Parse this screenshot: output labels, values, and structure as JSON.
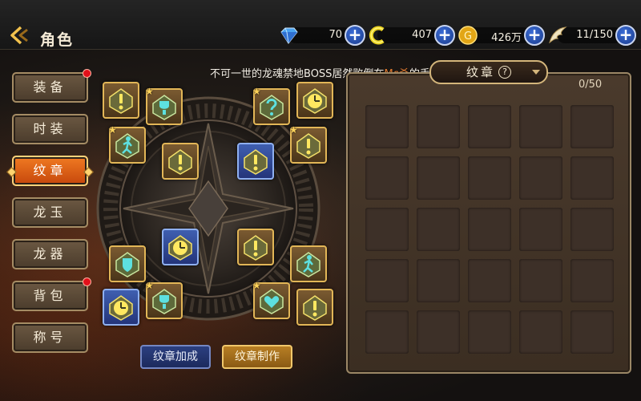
{
  "header": {
    "title": "角色",
    "resources": [
      {
        "icon": "diamond-icon",
        "value": "70"
      },
      {
        "icon": "c-coin-icon",
        "value": "407"
      },
      {
        "icon": "gold-coin-icon",
        "value": "426万"
      },
      {
        "icon": "wing-icon",
        "value": "11/150"
      }
    ]
  },
  "announcement": {
    "prefix": "不可一世的龙魂禁地BOSS居然败倒在",
    "name": "Mc杀",
    "suffix": "的手下"
  },
  "tabs": [
    {
      "label": "装备",
      "badge": true,
      "active": false
    },
    {
      "label": "时装",
      "badge": false,
      "active": false
    },
    {
      "label": "纹章",
      "badge": false,
      "active": true
    },
    {
      "label": "龙玉",
      "badge": false,
      "active": false
    },
    {
      "label": "龙器",
      "badge": false,
      "active": false
    },
    {
      "label": "背包",
      "badge": true,
      "active": false
    },
    {
      "label": "称号",
      "badge": false,
      "active": false
    }
  ],
  "emblem_slots": [
    {
      "name": "exclaim",
      "color": "gold",
      "star": false
    },
    {
      "name": "trophy",
      "color": "gold",
      "star": true
    },
    {
      "name": "runner",
      "color": "gold",
      "star": true
    },
    {
      "name": "exclaim",
      "color": "gold",
      "star": false
    },
    {
      "name": "question",
      "color": "gold",
      "star": true
    },
    {
      "name": "clock",
      "color": "gold",
      "star": false
    },
    {
      "name": "exclaim",
      "color": "blue",
      "star": false
    },
    {
      "name": "exclaim",
      "color": "gold",
      "star": true
    },
    {
      "name": "clock",
      "color": "blue",
      "star": false
    },
    {
      "name": "exclaim",
      "color": "gold",
      "star": false
    },
    {
      "name": "shield",
      "color": "gold",
      "star": false
    },
    {
      "name": "runner",
      "color": "gold",
      "star": false
    },
    {
      "name": "clock",
      "color": "blue",
      "star": false
    },
    {
      "name": "trophy",
      "color": "gold",
      "star": true
    },
    {
      "name": "heart",
      "color": "gold",
      "star": true
    },
    {
      "name": "exclaim",
      "color": "gold",
      "star": false
    }
  ],
  "buttons": {
    "combine": "纹章加成",
    "craft": "纹章制作"
  },
  "inventory": {
    "title": "纹章",
    "help": "?",
    "count": "0/50",
    "rows": 5,
    "cols": 5
  }
}
